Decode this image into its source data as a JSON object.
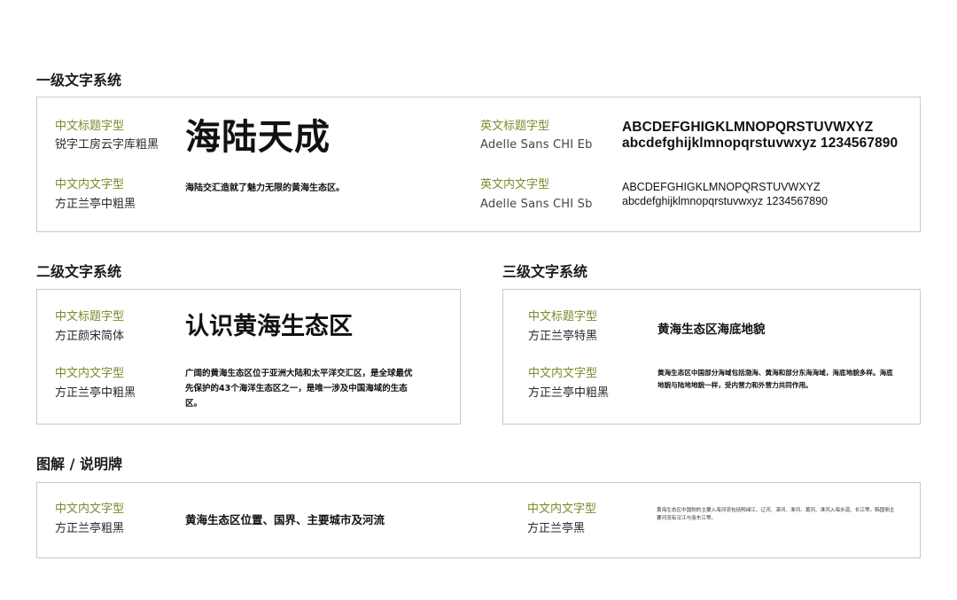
{
  "sections": {
    "level1": {
      "title": "一级文字系统",
      "cn_title": {
        "label": "中文标题字型",
        "font": "锐字工房云字库粗黑",
        "sample": "海陆天成"
      },
      "cn_body": {
        "label": "中文内文字型",
        "font": "方正兰亭中粗黑",
        "sample": "海陆交汇造就了魅力无限的黄海生态区。"
      },
      "en_title": {
        "label": "英文标题字型",
        "font": "Adelle Sans CHI Eb",
        "sample_line1": "ABCDEFGHIGKLMNOPQRSTUVWXYZ",
        "sample_line2": "abcdefghijklmnopqrstuvwxyz 1234567890"
      },
      "en_body": {
        "label": "英文内文字型",
        "font": "Adelle Sans CHI Sb",
        "sample_line1": "ABCDEFGHIGKLMNOPQRSTUVWXYZ",
        "sample_line2": "abcdefghijklmnopqrstuvwxyz 1234567890"
      }
    },
    "level2": {
      "title": "二级文字系统",
      "cn_title": {
        "label": "中文标题字型",
        "font": "方正颜宋简体",
        "sample": "认识黄海生态区"
      },
      "cn_body": {
        "label": "中文内文字型",
        "font": "方正兰亭中粗黑",
        "sample": "广阔的黄海生态区位于亚洲大陆和太平洋交汇区，是全球最优先保护的43个海洋生态区之一，是唯一涉及中国海域的生态区。"
      }
    },
    "level3": {
      "title": "三级文字系统",
      "cn_title": {
        "label": "中文标题字型",
        "font": "方正兰亭特黑",
        "sample": "黄海生态区海底地貌"
      },
      "cn_body": {
        "label": "中文内文字型",
        "font": "方正兰亭中粗黑",
        "sample": "黄海生态区中国部分海域包括渤海、黄海和部分东海海域，海底地貌多样。海底地貌与陆地地貌一样，受内营力和外营力共同作用。"
      }
    },
    "diagram": {
      "title": "图解 / 说明牌",
      "left": {
        "label": "中文内文字型",
        "font": "方正兰亭粗黑",
        "sample": "黄海生态区位置、国界、主要城市及河流"
      },
      "right": {
        "label": "中文内文字型",
        "font": "方正兰亭黑",
        "sample": "黄海生态区中国侧的主要入海河流包括鸭绿江、辽河、滦河、淮河、黄河、淮河入海水道、长江等，韩国侧主要河流有汉江与洛东江等。"
      }
    }
  },
  "colors": {
    "label_green": "#7c8a2a",
    "border": "#c8c8c8",
    "text": "#222222"
  }
}
